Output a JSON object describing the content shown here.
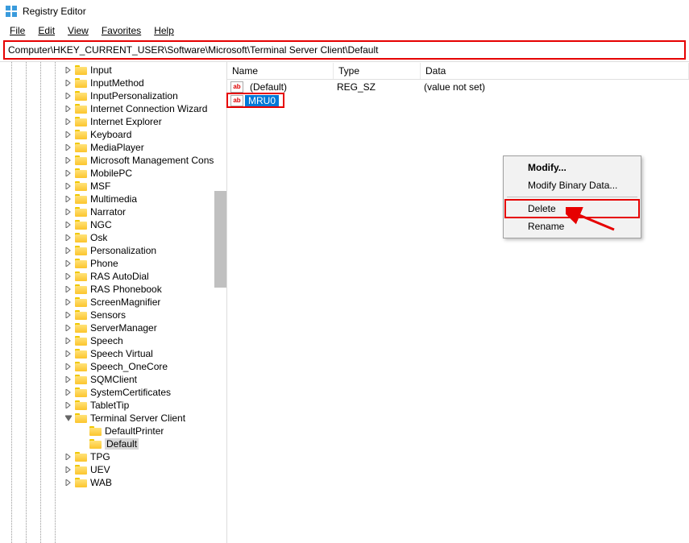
{
  "app": {
    "title": "Registry Editor"
  },
  "menu": {
    "file": "File",
    "edit": "Edit",
    "view": "View",
    "favorites": "Favorites",
    "help": "Help"
  },
  "address": "Computer\\HKEY_CURRENT_USER\\Software\\Microsoft\\Terminal Server Client\\Default",
  "tree": [
    {
      "depth": 4,
      "twist": ">",
      "label": "Input"
    },
    {
      "depth": 4,
      "twist": ">",
      "label": "InputMethod"
    },
    {
      "depth": 4,
      "twist": ">",
      "label": "InputPersonalization"
    },
    {
      "depth": 4,
      "twist": ">",
      "label": "Internet Connection Wizard"
    },
    {
      "depth": 4,
      "twist": ">",
      "label": "Internet Explorer"
    },
    {
      "depth": 4,
      "twist": ">",
      "label": "Keyboard"
    },
    {
      "depth": 4,
      "twist": ">",
      "label": "MediaPlayer"
    },
    {
      "depth": 4,
      "twist": ">",
      "label": "Microsoft Management Cons"
    },
    {
      "depth": 4,
      "twist": ">",
      "label": "MobilePC"
    },
    {
      "depth": 4,
      "twist": ">",
      "label": "MSF"
    },
    {
      "depth": 4,
      "twist": ">",
      "label": "Multimedia"
    },
    {
      "depth": 4,
      "twist": ">",
      "label": "Narrator"
    },
    {
      "depth": 4,
      "twist": ">",
      "label": "NGC"
    },
    {
      "depth": 4,
      "twist": ">",
      "label": "Osk"
    },
    {
      "depth": 4,
      "twist": ">",
      "label": "Personalization"
    },
    {
      "depth": 4,
      "twist": ">",
      "label": "Phone"
    },
    {
      "depth": 4,
      "twist": ">",
      "label": "RAS AutoDial"
    },
    {
      "depth": 4,
      "twist": ">",
      "label": "RAS Phonebook"
    },
    {
      "depth": 4,
      "twist": ">",
      "label": "ScreenMagnifier"
    },
    {
      "depth": 4,
      "twist": ">",
      "label": "Sensors"
    },
    {
      "depth": 4,
      "twist": ">",
      "label": "ServerManager"
    },
    {
      "depth": 4,
      "twist": ">",
      "label": "Speech"
    },
    {
      "depth": 4,
      "twist": ">",
      "label": "Speech Virtual"
    },
    {
      "depth": 4,
      "twist": ">",
      "label": "Speech_OneCore"
    },
    {
      "depth": 4,
      "twist": ">",
      "label": "SQMClient"
    },
    {
      "depth": 4,
      "twist": ">",
      "label": "SystemCertificates"
    },
    {
      "depth": 4,
      "twist": ">",
      "label": "TabletTip"
    },
    {
      "depth": 4,
      "twist": "v",
      "label": "Terminal Server Client"
    },
    {
      "depth": 5,
      "twist": "",
      "label": "DefaultPrinter"
    },
    {
      "depth": 5,
      "twist": "",
      "label": "Default",
      "selected": true
    },
    {
      "depth": 4,
      "twist": ">",
      "label": "TPG"
    },
    {
      "depth": 4,
      "twist": ">",
      "label": "UEV"
    },
    {
      "depth": 4,
      "twist": ">",
      "label": "WAB"
    }
  ],
  "list": {
    "headers": {
      "name": "Name",
      "type": "Type",
      "data": "Data"
    },
    "rows": [
      {
        "name": "(Default)",
        "type": "REG_SZ",
        "data": "(value not set)",
        "selected": false
      },
      {
        "name": "MRU0",
        "type": "",
        "data": "",
        "selected": true
      }
    ]
  },
  "context_menu": {
    "modify": "Modify...",
    "modify_binary": "Modify Binary Data...",
    "delete": "Delete",
    "rename": "Rename"
  }
}
